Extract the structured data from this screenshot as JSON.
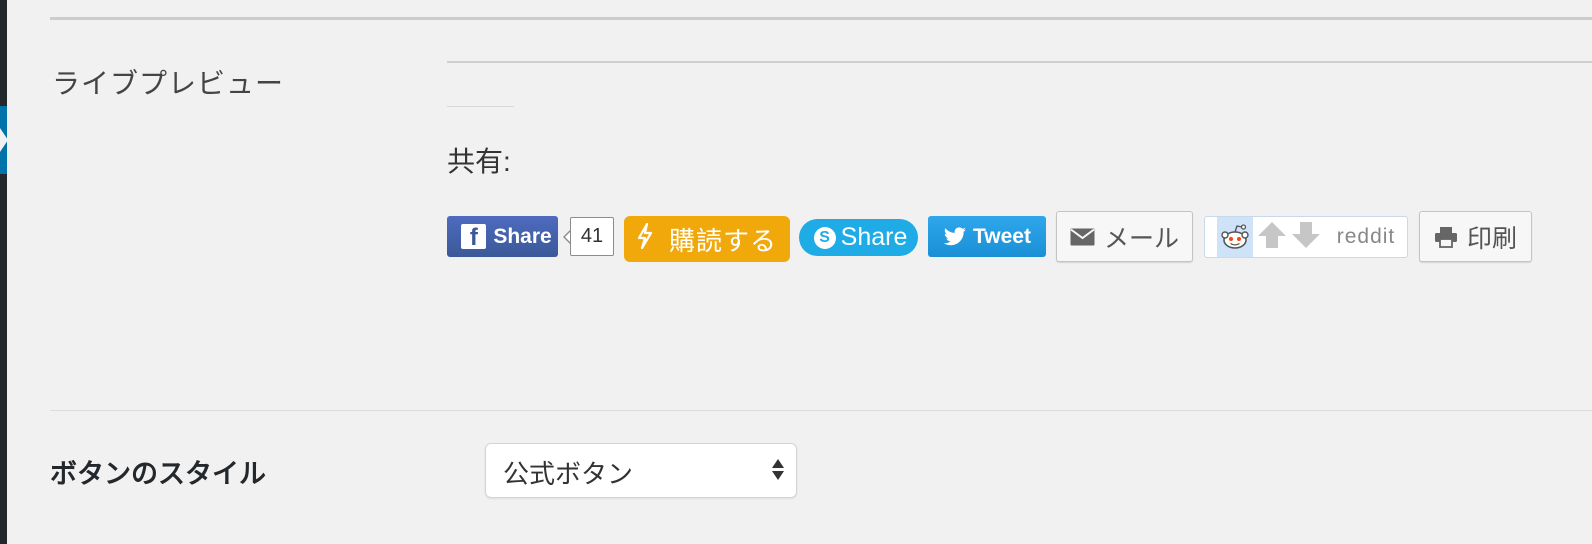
{
  "preview": {
    "label": "ライブプレビュー",
    "share_heading": "共有:"
  },
  "share_buttons": {
    "facebook": {
      "logo": "f",
      "label": "Share",
      "count": "41",
      "color": "#3b5998",
      "icon": "facebook-icon"
    },
    "subscribe": {
      "label": "購読する",
      "color": "#f0a80a",
      "icon": "bolt-icon"
    },
    "skype": {
      "logo": "S",
      "label": "Share",
      "color": "#1eabe6",
      "icon": "skype-icon"
    },
    "twitter": {
      "label": "Tweet",
      "color": "#1da1f2",
      "icon": "twitter-bird-icon"
    },
    "email": {
      "label": "メール",
      "icon": "envelope-icon"
    },
    "reddit": {
      "label": "reddit",
      "icons": [
        "reddit-alien-icon",
        "upvote-arrow-icon",
        "downvote-arrow-icon"
      ]
    },
    "print": {
      "label": "印刷",
      "icon": "printer-icon"
    }
  },
  "button_style": {
    "label": "ボタンのスタイル",
    "selected": "公式ボタン"
  },
  "colors": {
    "background": "#f1f1f1",
    "admin_sidebar": "#23282d",
    "admin_active": "#0073aa"
  }
}
